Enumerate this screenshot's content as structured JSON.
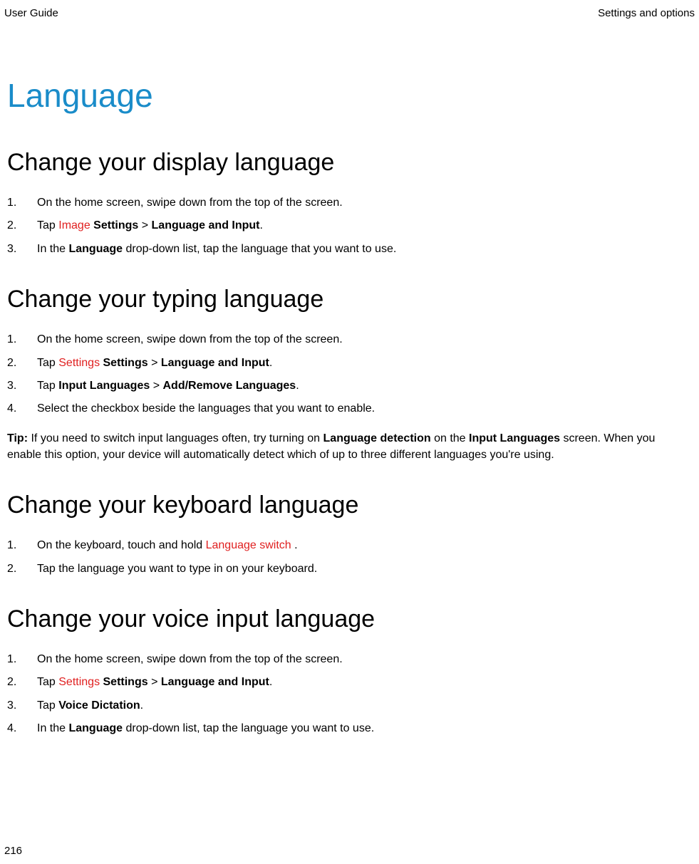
{
  "header": {
    "left": "User Guide",
    "right": "Settings and options"
  },
  "page_title": "Language",
  "sections": {
    "display": {
      "heading": "Change your display language",
      "steps": {
        "s1": "On the home screen, swipe down from the top of the screen.",
        "s2_prefix": "Tap ",
        "s2_image": "Image",
        "s2_settings": " Settings",
        "s2_gt": " > ",
        "s2_langinput": "Language and Input",
        "s2_suffix": ".",
        "s3_prefix": "In the ",
        "s3_lang": "Language",
        "s3_suffix": " drop-down list, tap the language that you want to use."
      }
    },
    "typing": {
      "heading": "Change your typing language",
      "steps": {
        "s1": "On the home screen, swipe down from the top of the screen.",
        "s2_prefix": "Tap ",
        "s2_image": "Settings",
        "s2_settings": " Settings",
        "s2_gt": " > ",
        "s2_langinput": "Language and Input",
        "s2_suffix": ".",
        "s3_prefix": "Tap ",
        "s3_inputlang": "Input Languages",
        "s3_gt": " > ",
        "s3_addremove": "Add/Remove Languages",
        "s3_suffix": ".",
        "s4": "Select the checkbox beside the languages that you want to enable."
      },
      "tip": {
        "label": "Tip:",
        "part1": " If you need to switch input languages often, try turning on ",
        "langdet": "Language detection",
        "part2": " on the ",
        "inputlang": "Input Languages",
        "part3": " screen. When you enable this option, your device will automatically detect which of up to three different languages you're using."
      }
    },
    "keyboard": {
      "heading": "Change your keyboard language",
      "steps": {
        "s1_prefix": "On the keyboard, touch and hold ",
        "s1_image": "Language switch",
        "s1_suffix": " .",
        "s2": "Tap the language you want to type in on your keyboard."
      }
    },
    "voice": {
      "heading": "Change your voice input language",
      "steps": {
        "s1": "On the home screen, swipe down from the top of the screen.",
        "s2_prefix": "Tap ",
        "s2_image": "Settings",
        "s2_settings": " Settings",
        "s2_gt": " > ",
        "s2_langinput": "Language and Input",
        "s2_suffix": ".",
        "s3_prefix": "Tap ",
        "s3_voice": "Voice Dictation",
        "s3_suffix": ".",
        "s4_prefix": "In the ",
        "s4_lang": "Language",
        "s4_suffix": " drop-down list, tap the language you want to use."
      }
    }
  },
  "page_number": "216"
}
